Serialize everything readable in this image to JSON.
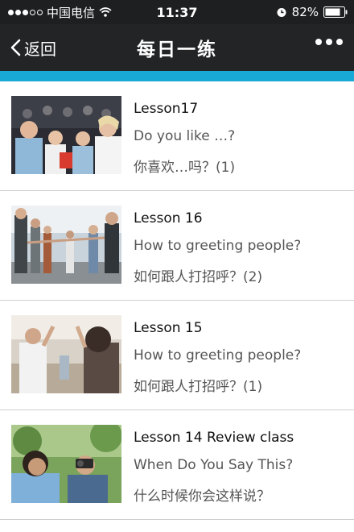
{
  "status_bar": {
    "carrier": "中国电信",
    "time": "11:37",
    "battery": "82%",
    "signal_icon": "signal-dots-icon",
    "wifi_icon": "wifi-icon",
    "alarm_icon": "alarm-icon",
    "battery_icon": "battery-icon"
  },
  "nav": {
    "back_label": "返回",
    "title": "每日一练",
    "more_icon": "more-dots-icon"
  },
  "colors": {
    "accent": "#19a9d6",
    "nav_bg": "#232426"
  },
  "lessons": [
    {
      "title": "Lesson17",
      "english": "Do you like …?",
      "chinese": "你喜欢…吗？(1)",
      "thumb_icon": "audience-photo"
    },
    {
      "title": "Lesson 16",
      "english": "How to greeting people?",
      "chinese": "如何跟人打招呼？(2)",
      "thumb_icon": "handshake-line-photo"
    },
    {
      "title": "Lesson 15",
      "english": "How to greeting people?",
      "chinese": "如何跟人打招呼？(1)",
      "thumb_icon": "waving-people-photo"
    },
    {
      "title": "Lesson 14 Review class",
      "english": "When Do You Say This?",
      "chinese": "什么时候你会这样说？",
      "thumb_icon": "photographer-photo"
    }
  ]
}
